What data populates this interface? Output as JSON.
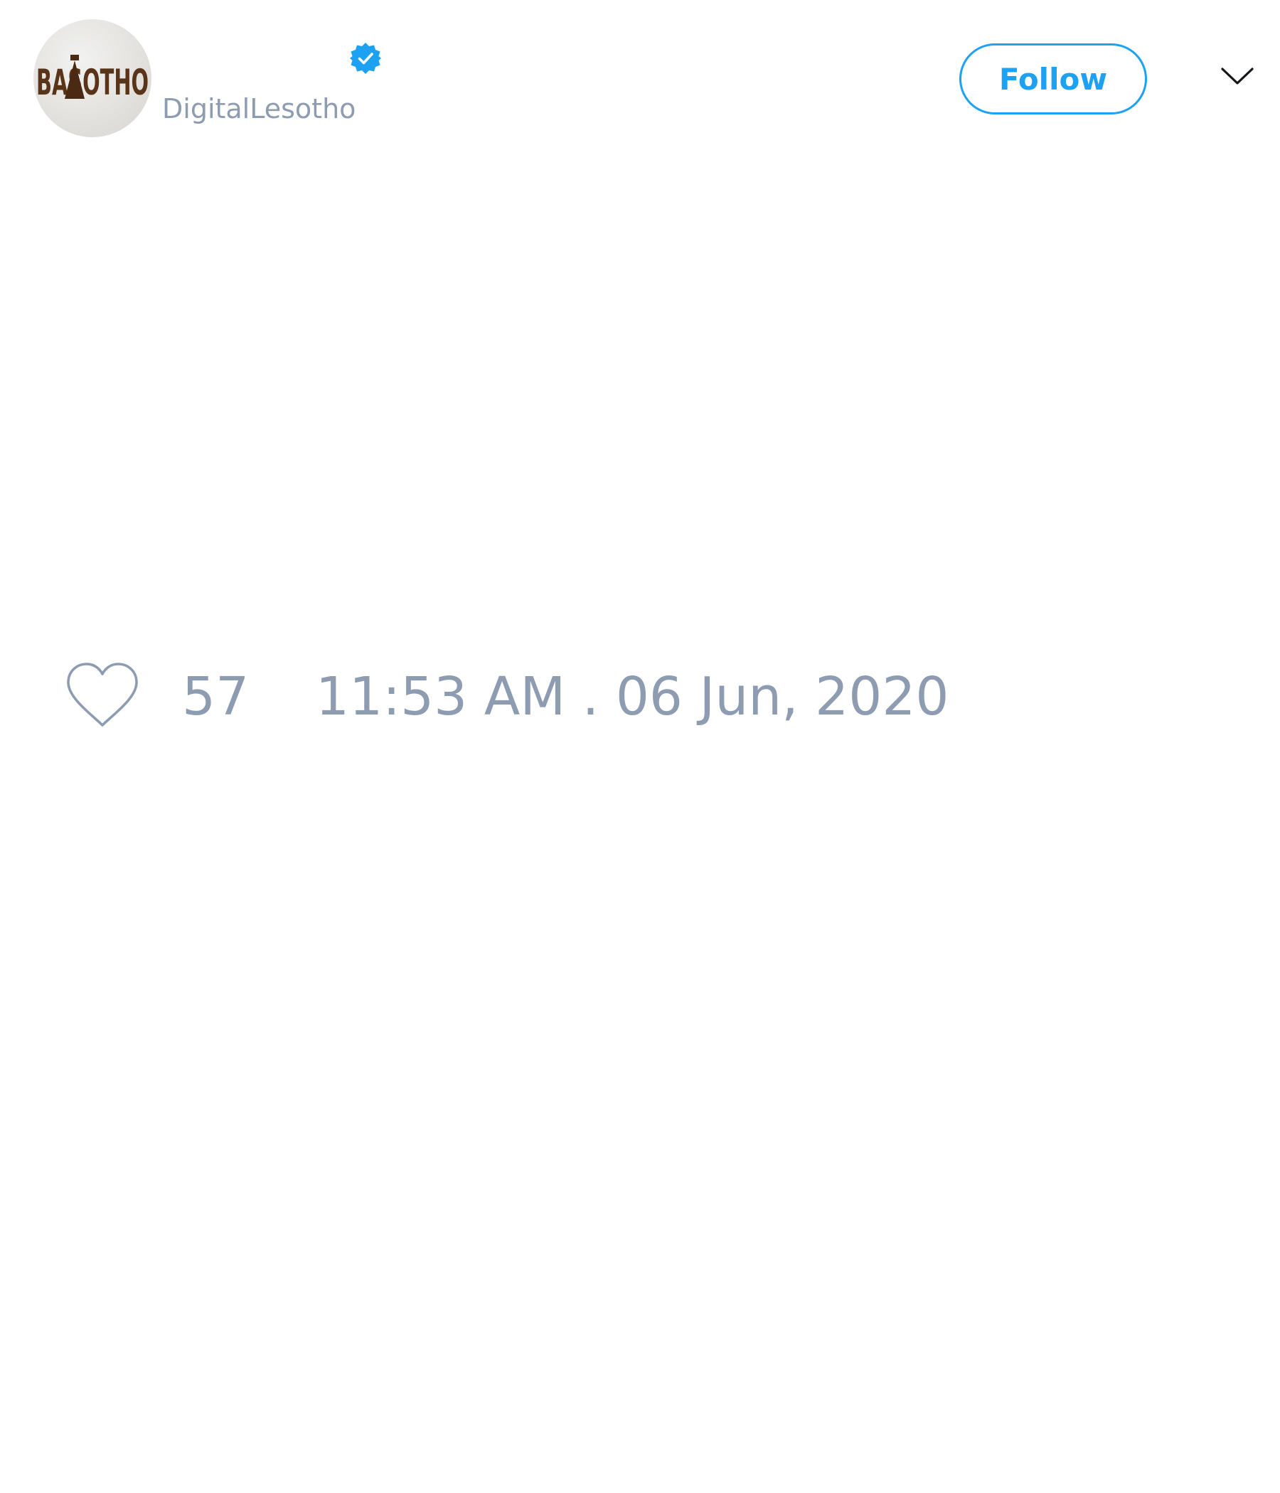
{
  "tweet": {
    "avatar": {
      "logo_text": "BASOTHO"
    },
    "author": {
      "display_name": "",
      "handle": "DigitalLesotho",
      "verified": true
    },
    "follow_label": "Follow",
    "like_count": "57",
    "timestamp": "11:53 AM . 06 Jun, 2020"
  },
  "icons": {
    "verified": "verified-badge-icon",
    "chevron": "chevron-down-icon",
    "like": "heart-icon"
  },
  "colors": {
    "accent": "#1da1f2",
    "muted_text": "#8d9cb0",
    "logo_brown": "#5a3418"
  }
}
